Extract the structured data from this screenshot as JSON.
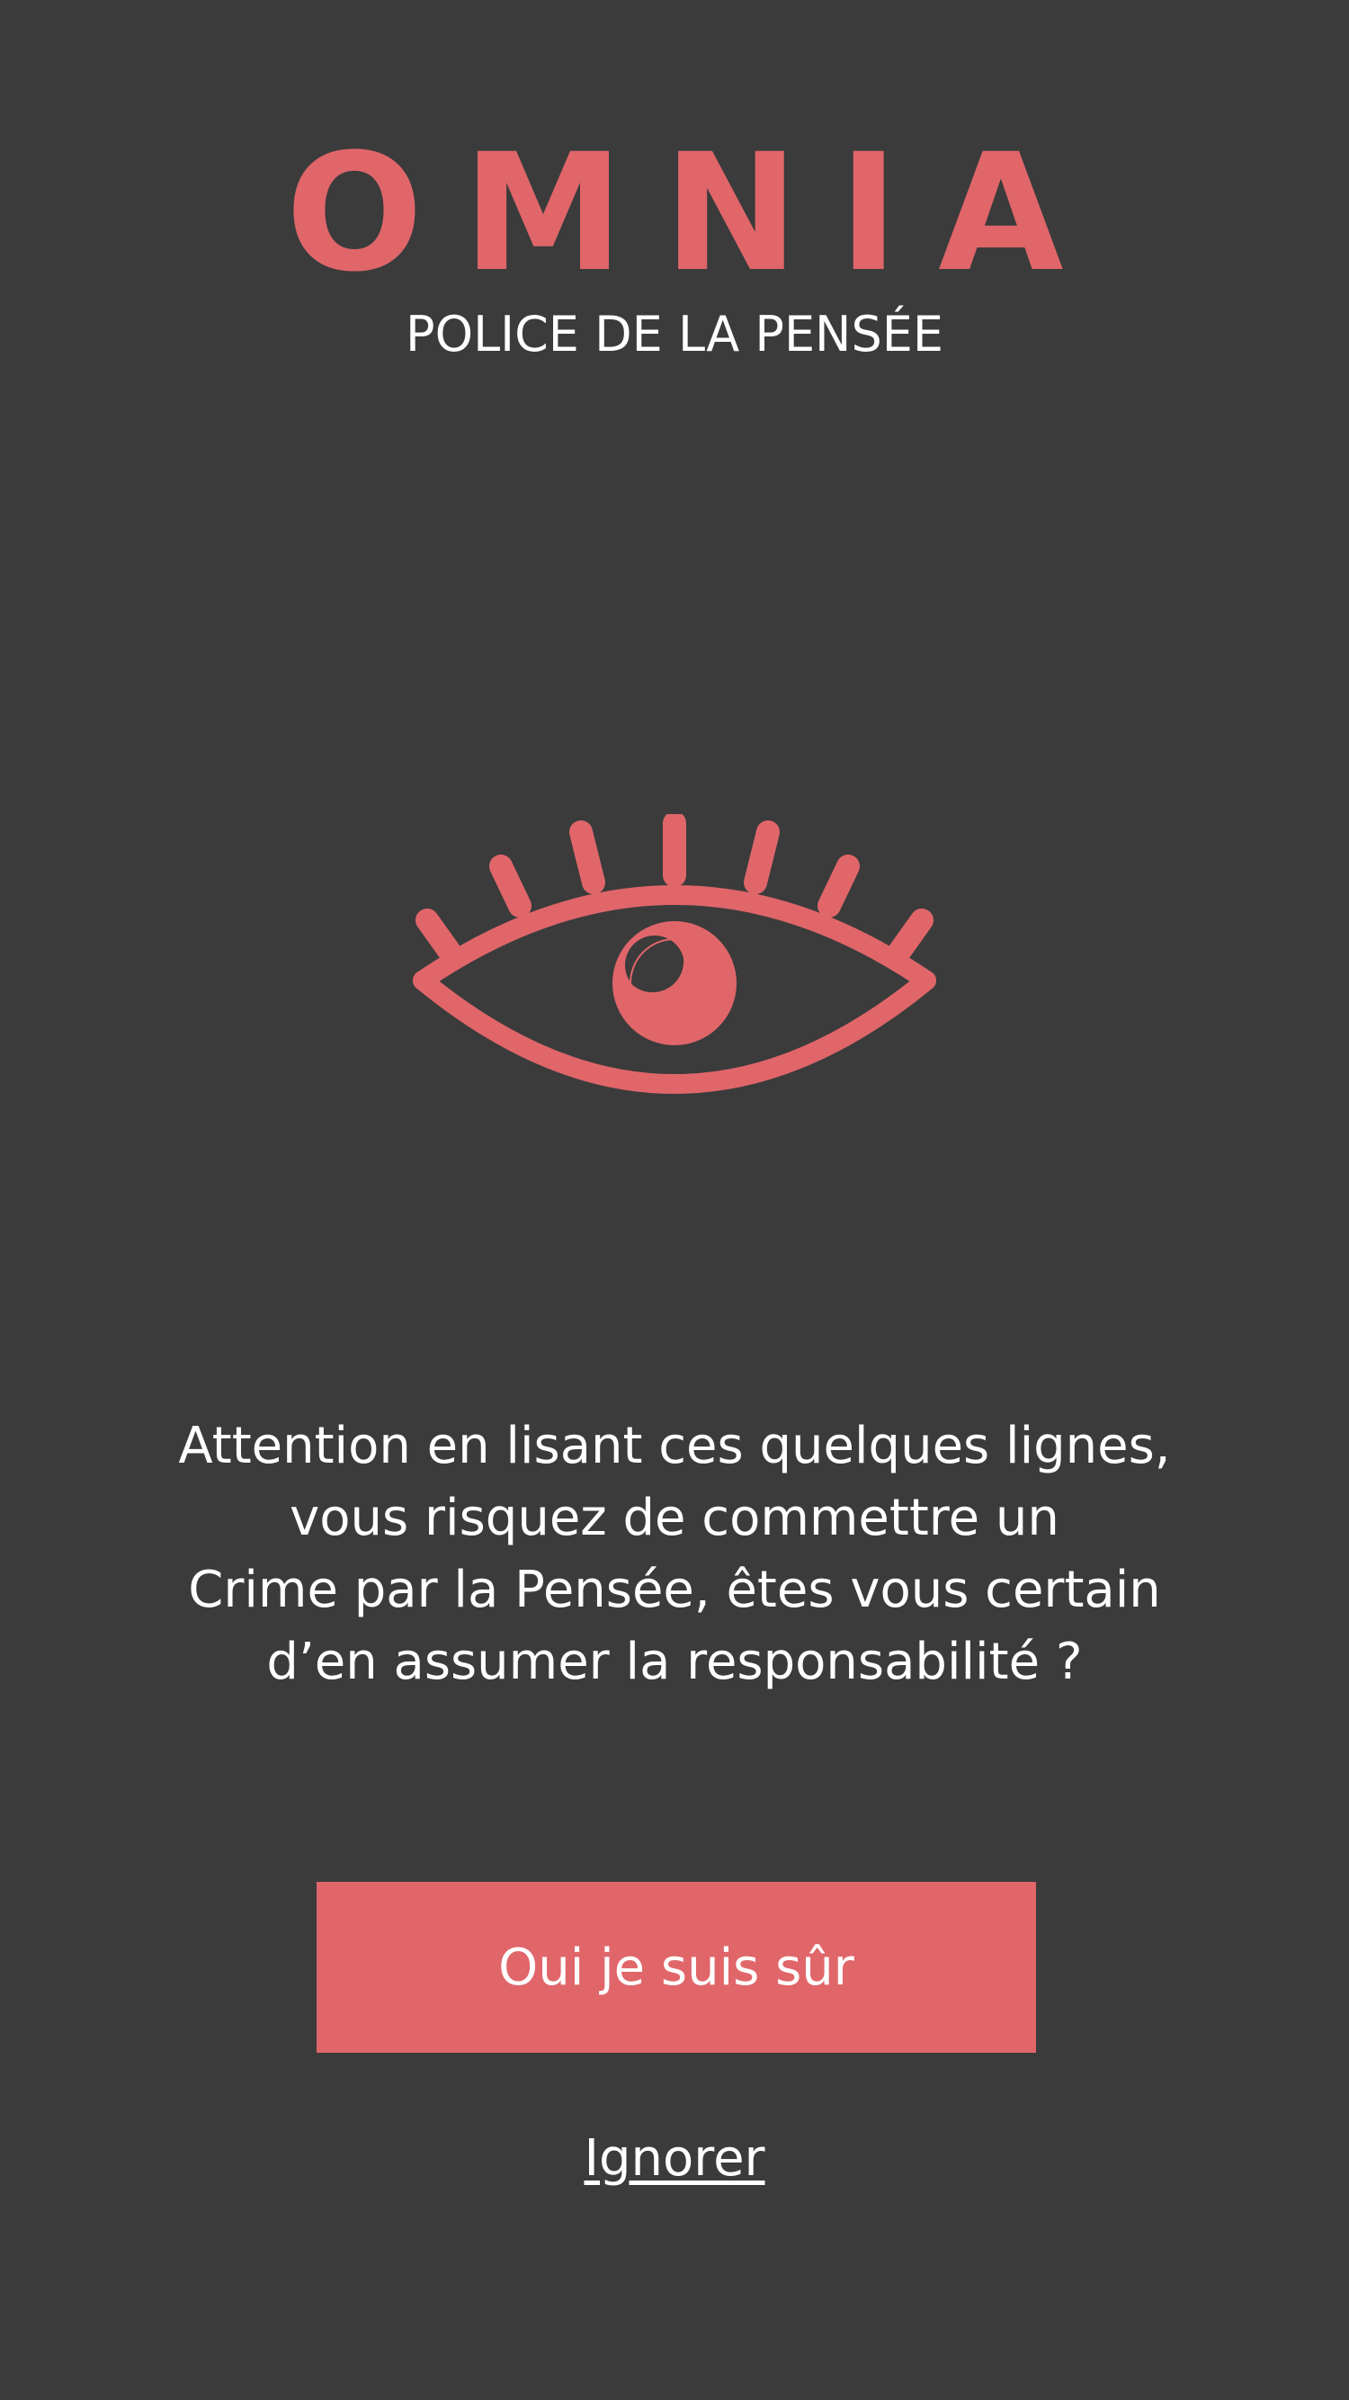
{
  "header": {
    "title": "OMNIA",
    "subtitle": "POLICE DE LA PENSÉE"
  },
  "hero": {
    "icon": "eye-icon"
  },
  "message": {
    "lines": [
      "Attention en lisant ces quelques lignes,",
      "vous risquez de commettre un",
      "Crime par la Pensée, êtes vous certain",
      "d’en assumer la responsabilité ?"
    ]
  },
  "actions": {
    "confirm_label": "Oui je suis sûr",
    "ignore_label": "Ignorer"
  },
  "colors": {
    "background": "#3b3b3b",
    "accent": "#e0666a",
    "text": "#ffffff"
  }
}
